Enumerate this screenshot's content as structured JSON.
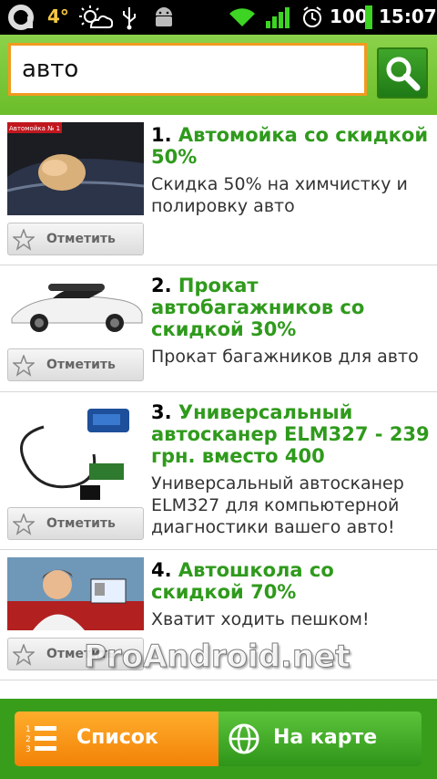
{
  "status_bar": {
    "temperature": "4°",
    "battery": "100",
    "time": "15:07",
    "icons": [
      "app-logo-icon",
      "weather-icon",
      "usb-icon",
      "android-debug-icon",
      "wifi-icon",
      "signal-icon",
      "alarm-icon",
      "battery-icon"
    ]
  },
  "search": {
    "value": "авто",
    "button_icon": "magnifier-icon"
  },
  "items": [
    {
      "number": "1.",
      "title": "Автомойка со скидкой 50%",
      "description": "Скидка 50% на химчистку и полировку авто",
      "mark_label": "Отметить",
      "thumb_caption": "Автомойка № 1"
    },
    {
      "number": "2.",
      "title": "Прокат автобагажников со скидкой 30%",
      "description": "Прокат багажников для авто",
      "mark_label": "Отметить"
    },
    {
      "number": "3.",
      "title": "Универсальный автосканер ELM327 - 239 грн. вместо 400",
      "description": "Универсальный автосканер ELM327 для компьютерной диагностики вашего авто!",
      "mark_label": "Отметить"
    },
    {
      "number": "4.",
      "title": "Автошкола со скидкой 70%",
      "description": "Хватит ходить пешком!",
      "mark_label": "Отметить"
    }
  ],
  "watermark": "ProAndroid.net",
  "bottom": {
    "list_label": "Список",
    "map_label": "На карте"
  },
  "colors": {
    "accent_green": "#2f9a1c",
    "orange": "#f28207",
    "header_green": "#7cc83a"
  }
}
